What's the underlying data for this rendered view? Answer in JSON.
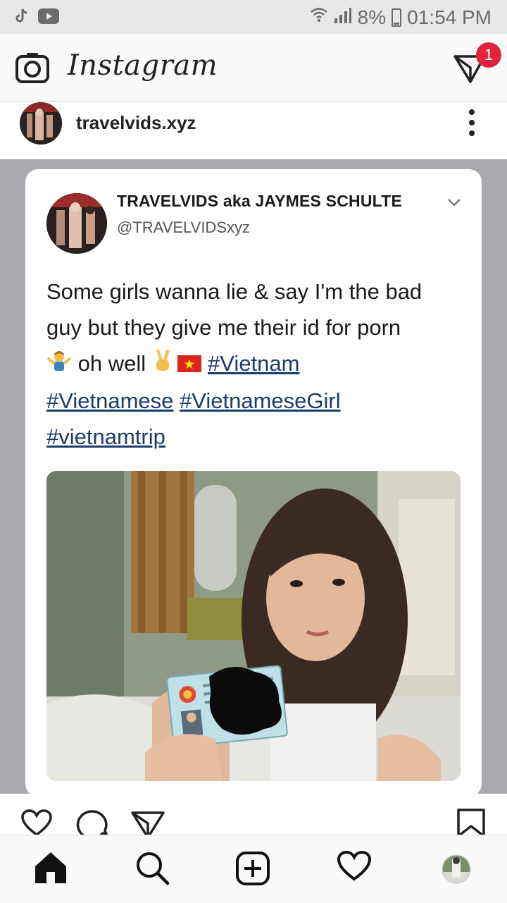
{
  "status_bar": {
    "battery_percent": "8%",
    "time": "01:54 PM",
    "left_icons": [
      "tiktok-icon",
      "youtube-icon"
    ],
    "right_icons": [
      "wifi-icon",
      "signal-icon",
      "battery-icon"
    ]
  },
  "header": {
    "app_name": "Instagram",
    "camera_icon": "camera-icon",
    "direct_icon": "direct-message-icon",
    "notification_count": "1",
    "badge_color": "#e0243d"
  },
  "post": {
    "username": "travelvids.xyz",
    "more_icon": "more-vertical-icon",
    "tweet": {
      "display_name": "TRAVELVIDS aka JAYMES SCHULTE",
      "handle": "@TRAVELVIDSxyz",
      "text_line1": "Some girls wanna lie & say I'm the bad",
      "text_line2": "guy but they give me their id for porn",
      "text_line3_plain": " oh well ",
      "hashtags": [
        "#Vietnam",
        "#Vietnamese",
        "#VietnameseGirl",
        "#vietnamtrip"
      ],
      "emojis": [
        "person-shrugging-emoji",
        "victory-hand-emoji",
        "vietnam-flag-emoji"
      ],
      "hashtag_color": "#1b3d6b"
    },
    "actions": [
      "like-icon",
      "comment-icon",
      "share-icon",
      "save-icon"
    ]
  },
  "bottom_nav": {
    "items": [
      "home-icon",
      "search-icon",
      "new-post-icon",
      "activity-icon",
      "profile-avatar"
    ]
  }
}
